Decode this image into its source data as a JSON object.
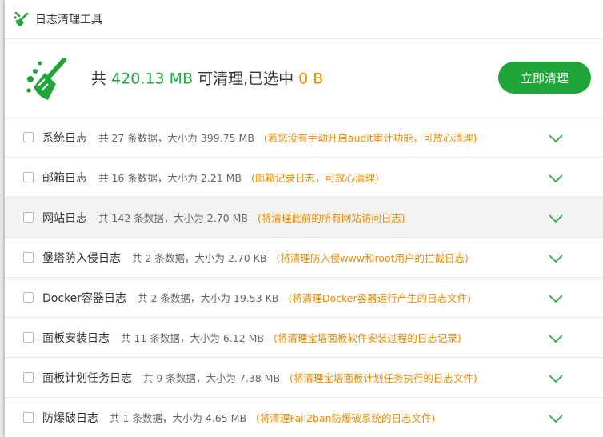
{
  "window": {
    "title": "日志清理工具"
  },
  "summary": {
    "prefix": "共",
    "total": "420.13 MB",
    "middle": "可清理,已选中",
    "selected": "0 B"
  },
  "actions": {
    "clean_label": "立即清理"
  },
  "colors": {
    "accent": "#20a53a",
    "note": "#f08a00"
  },
  "logs": [
    {
      "name": "系统日志",
      "count": "共 27 条数据，大小为 399.75 MB",
      "note": "(若您没有手动开启audit审计功能，可放心清理)",
      "checked": false
    },
    {
      "name": "邮箱日志",
      "count": "共 16 条数据，大小为 2.21 MB",
      "note": "(邮箱记录日志，可放心清理)",
      "checked": false
    },
    {
      "name": "网站日志",
      "count": "共 142 条数据，大小为 2.70 MB",
      "note": "(将清理此前的所有网站访问日志)",
      "checked": false
    },
    {
      "name": "堡塔防入侵日志",
      "count": "共 2 条数据，大小为 2.70 KB",
      "note": "(将清理防入侵www和root用户的拦截日志)",
      "checked": false
    },
    {
      "name": "Docker容器日志",
      "count": "共 2 条数据，大小为 19.53 KB",
      "note": "(将清理Docker容器运行产生的日志文件)",
      "checked": false
    },
    {
      "name": "面板安装日志",
      "count": "共 11 条数据，大小为 6.12 MB",
      "note": "(将清理宝塔面板软件安装过程的日志记录)",
      "checked": false
    },
    {
      "name": "面板计划任务日志",
      "count": "共 9 条数据，大小为 7.38 MB",
      "note": "(将清理宝塔面板计划任务执行的日志文件)",
      "checked": false
    },
    {
      "name": "防爆破日志",
      "count": "共 1 条数据，大小为 4.65 MB",
      "note": "(将清理Fail2ban防爆破系统的日志文件)",
      "checked": false
    }
  ]
}
